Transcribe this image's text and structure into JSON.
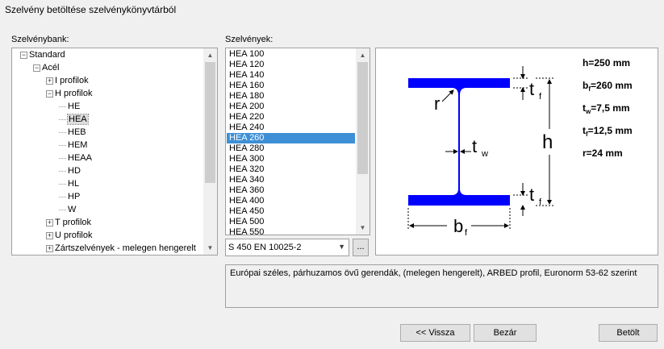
{
  "window": {
    "title": "Szelvény betöltése szelvénykönyvtárból"
  },
  "tree": {
    "label": "Szelvénybank:",
    "items": [
      {
        "text": "Standard",
        "level": 0,
        "expander": "−"
      },
      {
        "text": "Acél",
        "level": 1,
        "expander": "−"
      },
      {
        "text": "I profilok",
        "level": 2,
        "expander": "+"
      },
      {
        "text": "H profilok",
        "level": 2,
        "expander": "−"
      },
      {
        "text": "HE",
        "level": 3,
        "expander": ""
      },
      {
        "text": "HEA",
        "level": 3,
        "expander": "",
        "selected": true
      },
      {
        "text": "HEB",
        "level": 3,
        "expander": ""
      },
      {
        "text": "HEM",
        "level": 3,
        "expander": ""
      },
      {
        "text": "HEAA",
        "level": 3,
        "expander": ""
      },
      {
        "text": "HD",
        "level": 3,
        "expander": ""
      },
      {
        "text": "HL",
        "level": 3,
        "expander": ""
      },
      {
        "text": "HP",
        "level": 3,
        "expander": ""
      },
      {
        "text": "W",
        "level": 3,
        "expander": ""
      },
      {
        "text": "T profilok",
        "level": 2,
        "expander": "+"
      },
      {
        "text": "U profilok",
        "level": 2,
        "expander": "+"
      },
      {
        "text": "Zártszelvények - melegen hengerelt",
        "level": 2,
        "expander": "+"
      }
    ]
  },
  "sections": {
    "label": "Szelvények:",
    "items": [
      "HEA 100",
      "HEA 120",
      "HEA 140",
      "HEA 160",
      "HEA 180",
      "HEA 200",
      "HEA 220",
      "HEA 240",
      "HEA 260",
      "HEA 280",
      "HEA 300",
      "HEA 320",
      "HEA 340",
      "HEA 360",
      "HEA 400",
      "HEA 450",
      "HEA 500",
      "HEA 550"
    ],
    "selected": "HEA 260"
  },
  "material": {
    "value": "S 450 EN 10025-2",
    "more_label": "..."
  },
  "drawing": {
    "color": "#0000ff",
    "dims": {
      "h": {
        "name": "h",
        "value": "=250 mm"
      },
      "bf": {
        "name": "b",
        "sub": "f",
        "value": "=260 mm"
      },
      "tw": {
        "name": "t",
        "sub": "w",
        "value": "=7,5 mm"
      },
      "tf": {
        "name": "t",
        "sub": "f",
        "value": "=12,5 mm"
      },
      "r": {
        "name": "r",
        "value": "=24 mm"
      }
    },
    "labels": {
      "r": "r",
      "t": "t",
      "tf_sub": "f",
      "tw_sub": "w",
      "h": "h",
      "b": "b",
      "bf_sub": "f"
    }
  },
  "description": "Európai széles, párhuzamos övű gerendák, (melegen hengerelt), ARBED profil, Euronorm 53-62 szerint",
  "buttons": {
    "back": "<< Vissza",
    "close": "Bezár",
    "load": "Betölt"
  }
}
